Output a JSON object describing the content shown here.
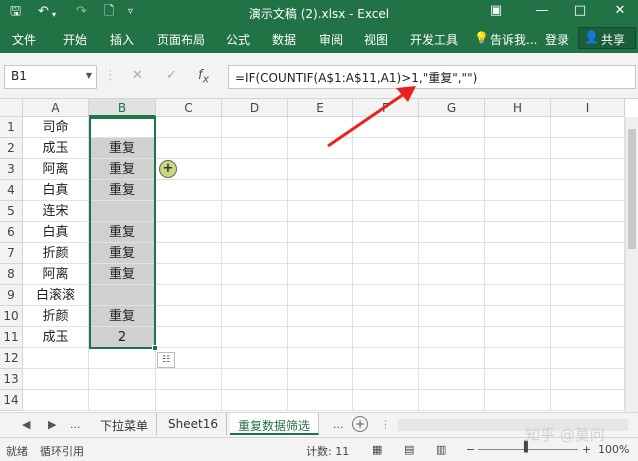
{
  "titlebar": {
    "title": "演示文稿 (2).xlsx - Excel",
    "save_icon": "save-icon",
    "undo_icon": "undo-icon",
    "redo_icon": "redo-icon",
    "new_icon": "new-file-icon",
    "customize_icon": "customize-icon",
    "ribbon_display_icon": "ribbon-display-icon",
    "minimize_icon": "minimize-icon",
    "maximize_icon": "maximize-icon",
    "close_icon": "close-icon"
  },
  "ribbon": {
    "tabs": [
      "文件",
      "开始",
      "插入",
      "页面布局",
      "公式",
      "数据",
      "审阅",
      "视图",
      "开发工具"
    ],
    "tell_me": "告诉我...",
    "login": "登录",
    "share": "共享"
  },
  "formula_bar": {
    "name_box": "B1",
    "formula": "=IF(COUNTIF(A$1:A$11,A1)>1,\"重复\",\"\")"
  },
  "grid": {
    "columns": [
      "A",
      "B",
      "C",
      "D",
      "E",
      "F",
      "G",
      "H",
      "I"
    ],
    "rows": [
      "1",
      "2",
      "3",
      "4",
      "5",
      "6",
      "7",
      "8",
      "9",
      "10",
      "11",
      "12",
      "13",
      "14"
    ],
    "col_a": [
      "司命",
      "成玉",
      "阿离",
      "白真",
      "连宋",
      "白真",
      "折颜",
      "阿离",
      "白滚滚",
      "折颜",
      "成玉",
      "",
      "",
      ""
    ],
    "col_b": [
      "",
      "重复",
      "重复",
      "重复",
      "",
      "重复",
      "重复",
      "重复",
      "",
      "重复",
      "2",
      "",
      "",
      ""
    ]
  },
  "sheets": {
    "nav_more": "...",
    "tabs": [
      "下拉菜单",
      "Sheet16",
      "重复数据筛选"
    ],
    "active": "重复数据筛选",
    "more": "..."
  },
  "statusbar": {
    "ready": "就绪",
    "circular": "循环引用",
    "count": "计数: 11",
    "zoom": "100%"
  },
  "watermark": "知乎 @莫问",
  "colors": {
    "excel_green": "#217346",
    "selection_fill": "#d0d0d0",
    "arrow_red": "#e8231f"
  }
}
